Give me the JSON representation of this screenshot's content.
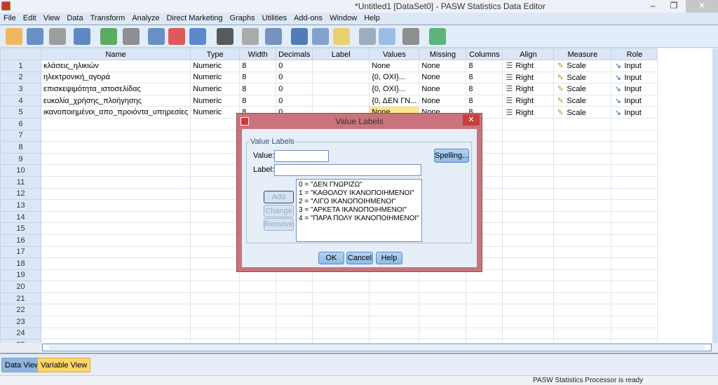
{
  "window": {
    "title": "*Untitled1 [DataSet0] - PASW Statistics Data Editor",
    "minimize": "–",
    "restore": "❐",
    "close": "✕"
  },
  "menu": [
    "File",
    "Edit",
    "View",
    "Data",
    "Transform",
    "Analyze",
    "Direct Marketing",
    "Graphs",
    "Utilities",
    "Add-ons",
    "Window",
    "Help"
  ],
  "toolbar": [
    "open-icon",
    "save-icon",
    "print-icon",
    "recall-dialog-icon",
    "undo-icon",
    "redo-icon",
    "goto-case-icon",
    "goto-variable-icon",
    "variables-icon",
    "find-icon",
    "insert-cases-icon",
    "insert-variable-icon",
    "split-file-icon",
    "weight-cases-icon",
    "select-cases-icon",
    "value-labels-icon",
    "use-sets-icon",
    "show-all-variables-icon",
    "spell-check-icon"
  ],
  "grid": {
    "headers": [
      "Name",
      "Type",
      "Width",
      "Decimals",
      "Label",
      "Values",
      "Missing",
      "Columns",
      "Align",
      "Measure",
      "Role"
    ],
    "rows": [
      [
        "κλάσεις_ηλικιών",
        "Numeric",
        "8",
        "0",
        "",
        "None",
        "None",
        "8",
        "Right",
        "Scale",
        "Input"
      ],
      [
        "ηλεκτρονική_αγορά",
        "Numeric",
        "8",
        "0",
        "",
        "{0, ΟΧΙ}...",
        "None",
        "8",
        "Right",
        "Scale",
        "Input"
      ],
      [
        "επισκεψιμότητα_ιστοσελίδας",
        "Numeric",
        "8",
        "0",
        "",
        "{0, ΟΧΙ}...",
        "None",
        "8",
        "Right",
        "Scale",
        "Input"
      ],
      [
        "ευκολία_χρήσης_πλοήγησης",
        "Numeric",
        "8",
        "0",
        "",
        "{0, ΔΕΝ ΓΝ...",
        "None",
        "8",
        "Right",
        "Scale",
        "Input"
      ],
      [
        "ικανοποιημένοι_απο_προιόντα_υπηρεσίες",
        "Numeric",
        "8",
        "0",
        "",
        "None",
        "None",
        "8",
        "Right",
        "Scale",
        "Input"
      ]
    ],
    "row_count": 25
  },
  "tabs": {
    "data_view": "Data View",
    "variable_view": "Variable View",
    "active": "Variable View"
  },
  "status": "PASW Statistics Processor is ready",
  "dialog": {
    "title": "Value Labels",
    "group": "Value Labels",
    "value_label": "Value:",
    "value": "",
    "label_label": "Label:",
    "label": "",
    "spelling": "Spelling...",
    "add": "Add",
    "change": "Change",
    "remove": "Remove",
    "list": [
      "0 = \"ΔΕΝ ΓΝΩΡΙΖΩ\"",
      "1 = \"ΚΑΘΟΛΟΥ ΙΚΑΝΟΠΟΙΗΜΕΝΟΙ\"",
      "2 = \"ΛΙΓΟ ΙΚΑΝΟΠΟΙΗΜΕΝΟΙ\"",
      "3 = \"ΑΡΚΕΤΑ ΙΚΑΝΟΠΟΙΗΜΕΝΟΙ\"",
      "4 = \"ΠΑΡΑ ΠΟΛΥ ΙΚΑΝΟΠΟΙΗΜΕΝΟΙ\""
    ],
    "ok": "OK",
    "cancel": "Cancel",
    "help": "Help"
  }
}
